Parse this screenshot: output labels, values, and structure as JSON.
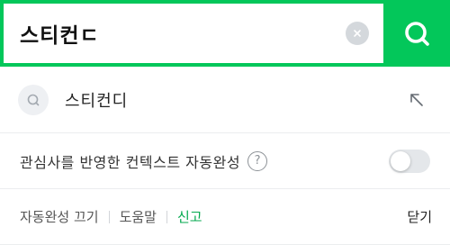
{
  "search": {
    "query": "스티컨ㄷ"
  },
  "icons": {
    "clear": "clear-x-icon",
    "search": "search-magnifier-icon",
    "suggest": "search-history-icon",
    "fill": "arrow-up-left-icon",
    "help": "help-question-icon"
  },
  "suggestions": [
    {
      "text": "스티컨디"
    }
  ],
  "context": {
    "label": "관심사를 반영한 컨텍스트 자동완성",
    "help_glyph": "?",
    "toggle_on": false
  },
  "footer": {
    "autocomplete_off": "자동완성 끄기",
    "help": "도움말",
    "report": "신고",
    "close": "닫기"
  },
  "colors": {
    "brand_green": "#03c75a",
    "report_green": "#03a94e"
  }
}
